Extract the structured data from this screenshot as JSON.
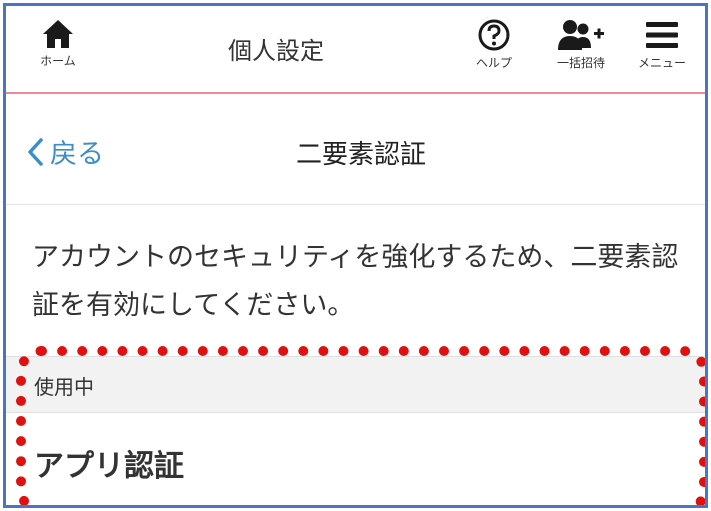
{
  "header": {
    "title": "個人設定",
    "home_label": "ホーム",
    "help_label": "ヘルプ",
    "invite_label": "一括招待",
    "menu_label": "メニュー",
    "icons": {
      "home": "home-icon",
      "help": "help-circle-icon",
      "invite": "add-users-icon",
      "menu": "hamburger-menu-icon"
    }
  },
  "subheader": {
    "back_label": "戻る",
    "title": "二要素認証"
  },
  "description": "アカウントのセキュリティを強化するため、二要素認証を有効にしてください。",
  "section": {
    "header": "使用中",
    "item": "アプリ認証"
  },
  "colors": {
    "accent": "#3b8ec9",
    "header_divider": "#f28a93",
    "annotation": "#e01010",
    "frame": "#4a74c4"
  }
}
